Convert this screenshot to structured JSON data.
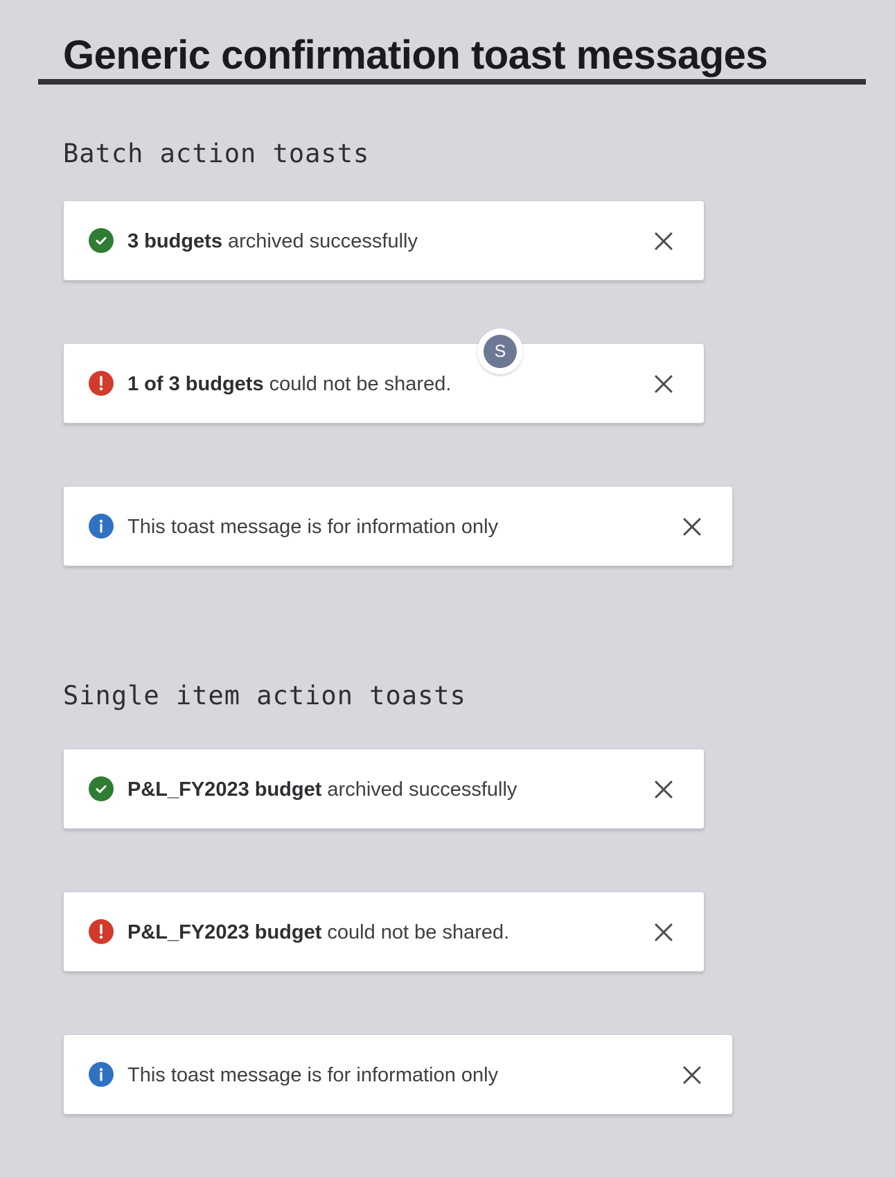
{
  "page": {
    "title": "Generic confirmation toast messages"
  },
  "colors": {
    "success": "#2e7d32",
    "error": "#d23a2c",
    "info": "#2f72c4",
    "avatar": "#6d7895"
  },
  "batch": {
    "heading": "Batch action toasts",
    "toasts": [
      {
        "type": "success",
        "icon": "check-circle-icon",
        "bold": "3 budgets",
        "text": "archived successfully"
      },
      {
        "type": "error",
        "icon": "exclamation-circle-icon",
        "bold": "1 of 3 budgets",
        "text": "could not be shared."
      },
      {
        "type": "info",
        "icon": "info-circle-icon",
        "bold": "",
        "text": "This toast message is for information only"
      }
    ]
  },
  "single": {
    "heading": "Single item action toasts",
    "toasts": [
      {
        "type": "success",
        "icon": "check-circle-icon",
        "bold": "P&L_FY2023 budget",
        "text": "archived successfully"
      },
      {
        "type": "error",
        "icon": "exclamation-circle-icon",
        "bold": "P&L_FY2023 budget",
        "text": "could not be shared."
      },
      {
        "type": "info",
        "icon": "info-circle-icon",
        "bold": "",
        "text": "This toast message is for information only"
      }
    ]
  },
  "avatar": {
    "initial": "S"
  }
}
